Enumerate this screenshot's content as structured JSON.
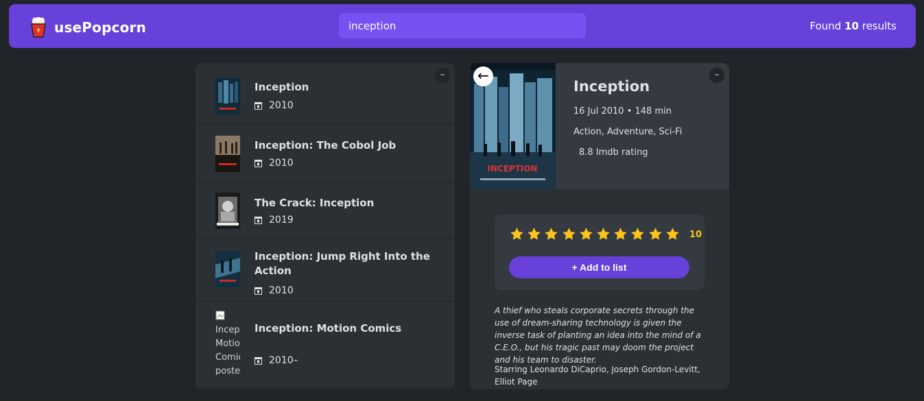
{
  "app": {
    "name": "usePopcorn"
  },
  "search": {
    "value": "inception"
  },
  "results": {
    "prefix": "Found",
    "count": "10",
    "suffix": "results"
  },
  "list": {
    "toggle": "–",
    "movies": [
      {
        "title": "Inception",
        "year": "2010"
      },
      {
        "title": "Inception: The Cobol Job",
        "year": "2010"
      },
      {
        "title": "The Crack: Inception",
        "year": "2019"
      },
      {
        "title": "Inception: Jump Right Into the Action",
        "year": "2010"
      },
      {
        "title": "Inception: Motion Comics",
        "year": "2010–",
        "poster_alt": "Inception: Motion Comics poster"
      }
    ]
  },
  "details": {
    "toggle": "–",
    "back": "←",
    "title": "Inception",
    "released_runtime": "16 Jul 2010 • 148 min",
    "genre": "Action, Adventure, Sci-Fi",
    "imdb": "8.8 Imdb rating",
    "user_rating": "10",
    "add_label": "+ Add to list",
    "plot": "A thief who steals corporate secrets through the use of dream-sharing technology is given the inverse task of planting an idea into the mind of a C.E.O., but his tragic past may doom the project and his team to disaster.",
    "starring": "Starring Leonardo DiCaprio, Joseph Gordon-Levitt, Elliot Page",
    "poster_text": "INCEPTION"
  },
  "colors": {
    "nav": "#6741d9",
    "search": "#7950f2",
    "background": "#212529",
    "box": "#2b3035",
    "panel": "#343a40",
    "star": "#fcc419"
  }
}
